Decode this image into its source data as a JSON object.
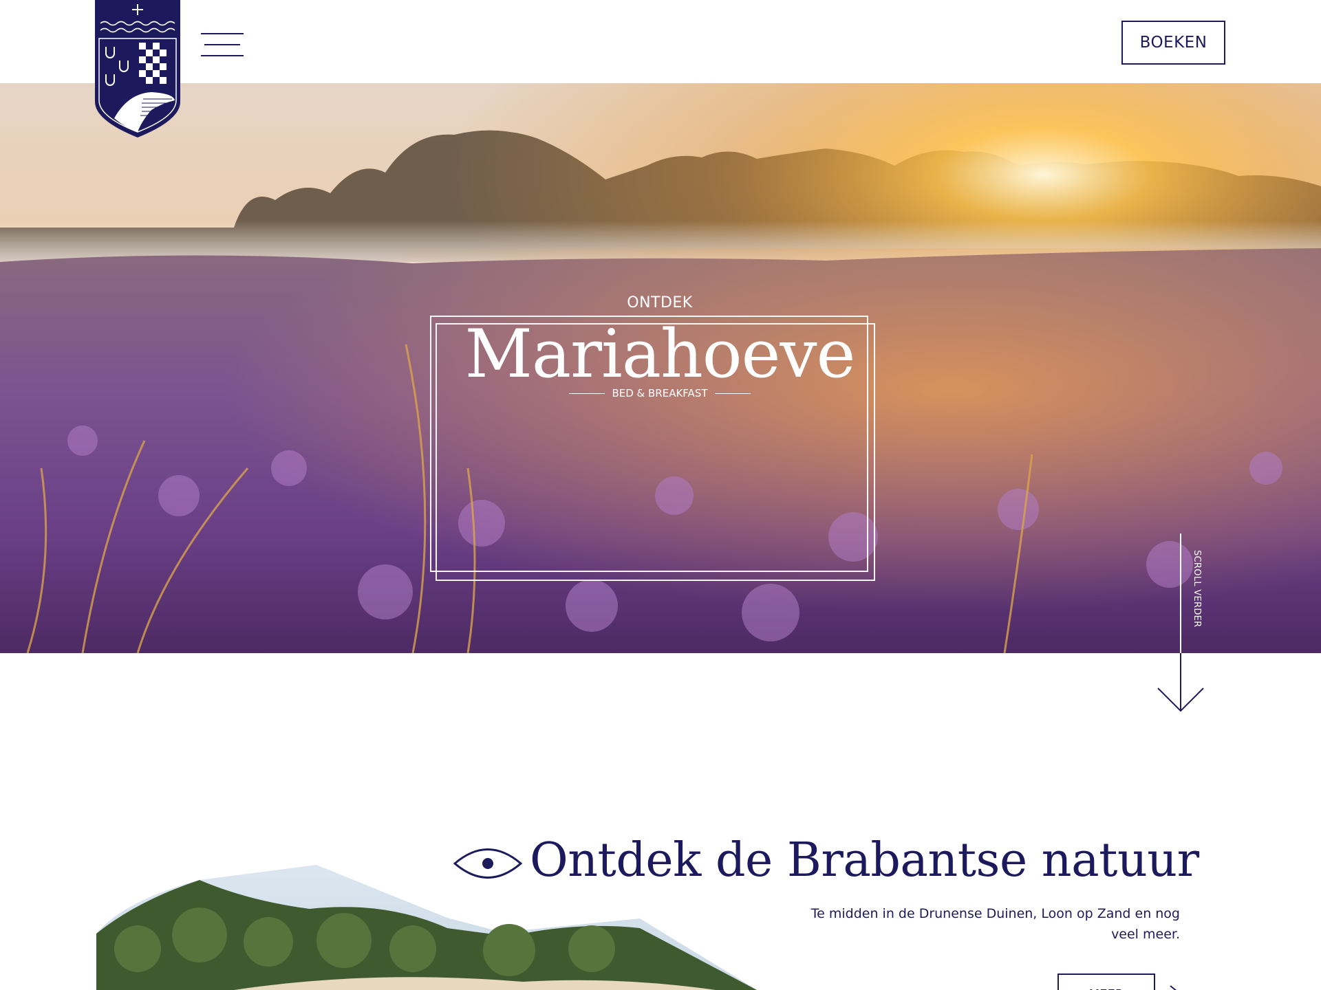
{
  "header": {
    "logo_icon": "coat-of-arms-shield",
    "menu_icon": "hamburger-icon",
    "book_label": "BOEKEN"
  },
  "hero": {
    "kicker": "ONTDEK",
    "title": "Mariahoeve",
    "subtitle": "BED & BREAKFAST",
    "scroll_label": "SCROLL VERDER",
    "scroll_icon": "arrow-down-icon"
  },
  "discover": {
    "icon": "eye-icon",
    "title": "Ontdek  de Brabantse natuur",
    "text": "Te midden in de Drunense Duinen, Loon op Zand en nog veel meer.",
    "more_label": "MEER"
  },
  "colors": {
    "brand": "#1c1a5c",
    "background": "#ffffff"
  }
}
